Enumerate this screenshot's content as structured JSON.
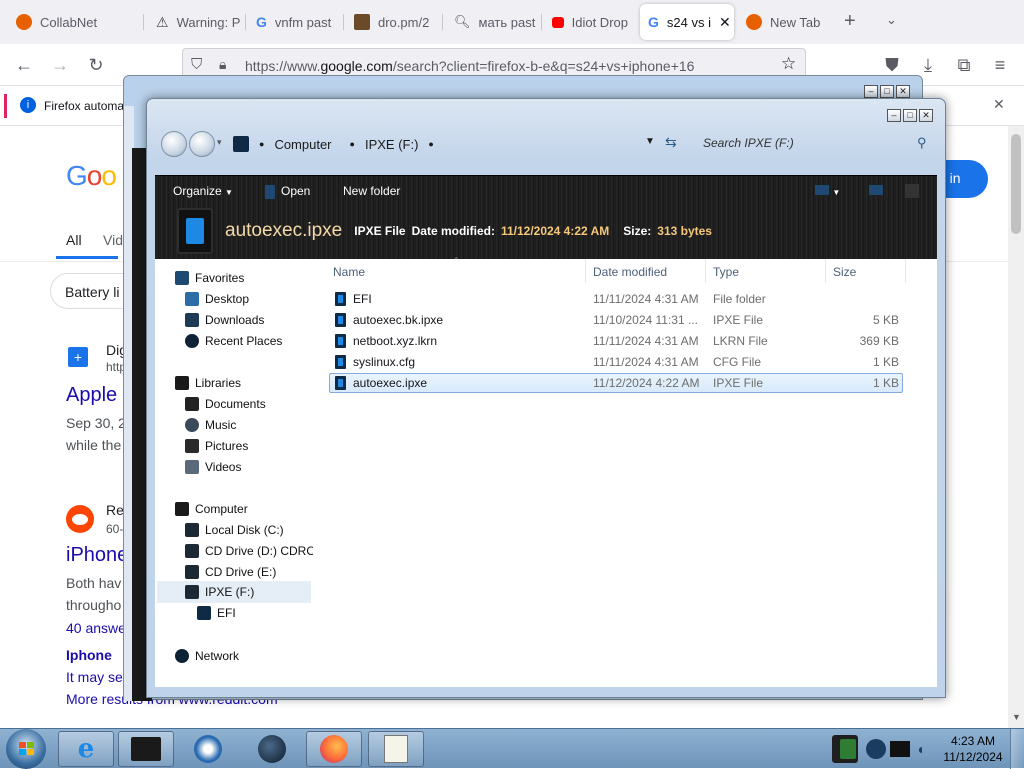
{
  "browser": {
    "tabs": [
      {
        "label": "CollabNet",
        "favicon": "firefox-icon",
        "color": "#e66000"
      },
      {
        "label": "Warning: P",
        "favicon": "warning-icon",
        "color": "#444444"
      },
      {
        "label": "vnfm past",
        "favicon": "google-icon",
        "color": "#4285f4"
      },
      {
        "label": "dro.pm/2",
        "favicon": "image-icon",
        "color": "#6b4a2a"
      },
      {
        "label": "мать past",
        "favicon": "search-icon",
        "color": "#555555"
      },
      {
        "label": "Idiot Drop",
        "favicon": "youtube-icon",
        "color": "#ff0000"
      },
      {
        "label": "s24 vs i",
        "favicon": "google-icon",
        "color": "#4285f4"
      },
      {
        "label": "New Tab",
        "favicon": "firefox-icon",
        "color": "#e66000"
      }
    ],
    "url_prefix": "https://www.",
    "url_domain": "google.com",
    "url_rest": "/search?client=firefox-b-e&q=s24+vs+iphone+16",
    "infobar_text": "Firefox automa"
  },
  "google": {
    "logo": "Goo",
    "tab_all": "All",
    "tab_videos": "Vid",
    "sign_in": "n in",
    "chip": "Battery li",
    "r1_site": "Dig",
    "r1_url": "http",
    "r1_title": "Apple",
    "r1_date": "Sep 30, 2",
    "r1_snip": "while the",
    "r2_site": "Re",
    "r2_url": "60-",
    "r2_title": "iPhone",
    "r2_s1": "Both hav",
    "r2_s2": "througho",
    "r2_answers": "40 answe",
    "r2_q": "Iphone",
    "r2_may": "It may seem",
    "more_results": "More results from www.reddit.com"
  },
  "explorer": {
    "breadcrumb": [
      "Computer",
      "IPXE (F:)"
    ],
    "search_placeholder": "Search IPXE (F:)",
    "cmd_organize": "Organize",
    "cmd_open": "Open",
    "cmd_newfolder": "New folder",
    "details": {
      "filename": "autoexec.ipxe",
      "type": "IPXE File",
      "date_label": "Date modified:",
      "date_value": "11/12/2024 4:22 AM",
      "size_label": "Size:",
      "size_value": "313 bytes"
    },
    "nav": {
      "favorites": "Favorites",
      "desktop": "Desktop",
      "downloads": "Downloads",
      "recent": "Recent Places",
      "libraries": "Libraries",
      "documents": "Documents",
      "music": "Music",
      "pictures": "Pictures",
      "videos": "Videos",
      "computer": "Computer",
      "local_disk": "Local Disk (C:)",
      "cd_d": "CD Drive (D:) CDROM",
      "cd_e": "CD Drive (E:)",
      "ipxe": "IPXE (F:)",
      "efi": "EFI",
      "network": "Network"
    },
    "columns": {
      "name": "Name",
      "date": "Date modified",
      "type": "Type",
      "size": "Size"
    },
    "files": [
      {
        "name": "EFI",
        "date": "11/11/2024 4:31 AM",
        "type": "File folder",
        "size": ""
      },
      {
        "name": "autoexec.bk.ipxe",
        "date": "11/10/2024 11:31 ...",
        "type": "IPXE File",
        "size": "5 KB"
      },
      {
        "name": "netboot.xyz.lkrn",
        "date": "11/11/2024 4:31 AM",
        "type": "LKRN File",
        "size": "369 KB"
      },
      {
        "name": "syslinux.cfg",
        "date": "11/11/2024 4:31 AM",
        "type": "CFG File",
        "size": "1 KB"
      },
      {
        "name": "autoexec.ipxe",
        "date": "11/12/2024 4:22 AM",
        "type": "IPXE File",
        "size": "1 KB"
      }
    ],
    "selected_index": 4
  },
  "taskbar": {
    "time": "4:23 AM",
    "date": "11/12/2024"
  }
}
